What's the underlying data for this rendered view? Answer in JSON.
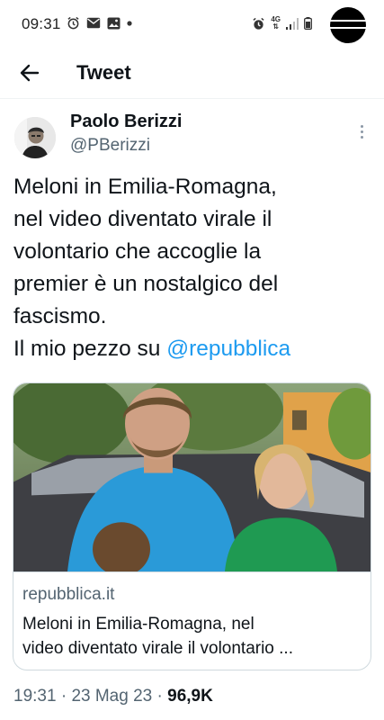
{
  "status_bar": {
    "time": "09:31",
    "network": "4G"
  },
  "header": {
    "title": "Tweet"
  },
  "author": {
    "name": "Paolo Berizzi",
    "handle": "@PBerizzi"
  },
  "tweet": {
    "lines": [
      "Meloni in Emilia-Romagna,",
      "nel video diventato virale il",
      "volontario che accoglie la",
      "premier è un nostalgico del",
      "fascismo."
    ],
    "last_line_prefix": "Il mio pezzo su ",
    "mention": "@repubblica"
  },
  "link_card": {
    "domain": "repubblica.it",
    "title_lines": [
      "Meloni in Emilia-Romagna, nel",
      "video diventato virale il volontario ..."
    ]
  },
  "meta": {
    "time": "19:31",
    "sep1": " · ",
    "date": "23 Mag 23",
    "sep2": " · ",
    "views": "96,9K"
  },
  "colors": {
    "accent": "#1d9bf0",
    "text": "#0f1419",
    "secondary": "#536471"
  }
}
